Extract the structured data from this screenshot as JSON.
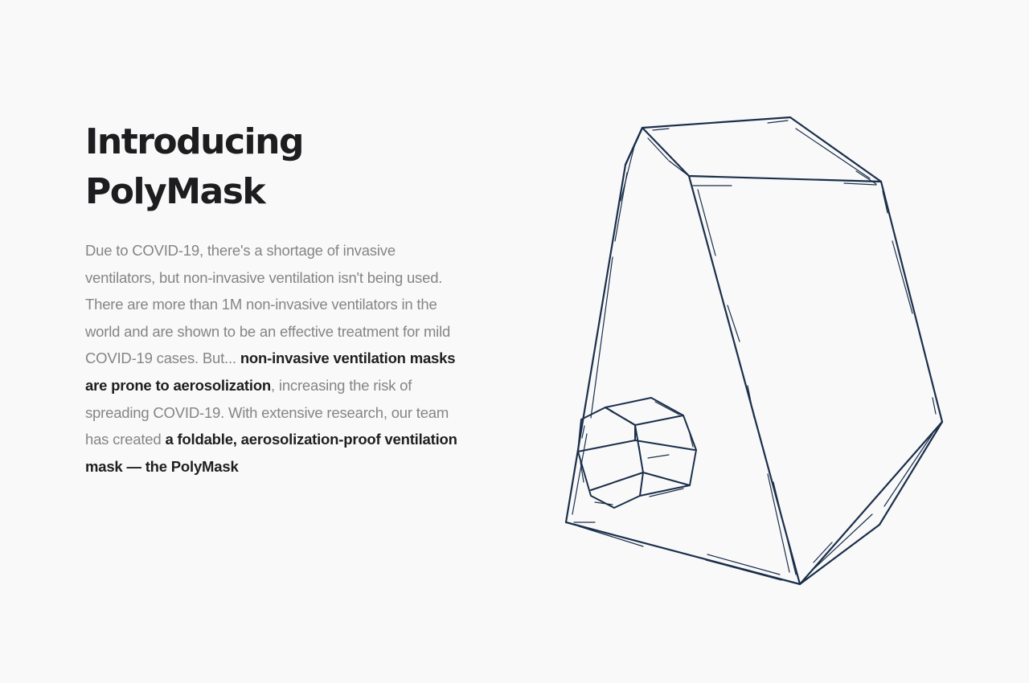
{
  "hero": {
    "title_line1": "Introducing",
    "title_line2": "PolyMask",
    "intro": {
      "part1": "Due to COVID-19, there's a shortage of invasive ventilators, but non-invasive ventilation isn't being used. There are more than 1M non-invasive ventilators in the world and are shown to be an effective treatment for mild COVID-19 cases. But...",
      "emphasis1": "non-invasive ventilation masks are prone to aerosolization",
      "part2": ", increasing the risk of spreading COVID-19. With extensive research, our team has created",
      "emphasis2": "a foldable, aerosolization-proof ventilation mask — the PolyMask"
    }
  },
  "illustration": {
    "icon": "polymask-line-drawing",
    "stroke_color": "#1b2f4a"
  }
}
